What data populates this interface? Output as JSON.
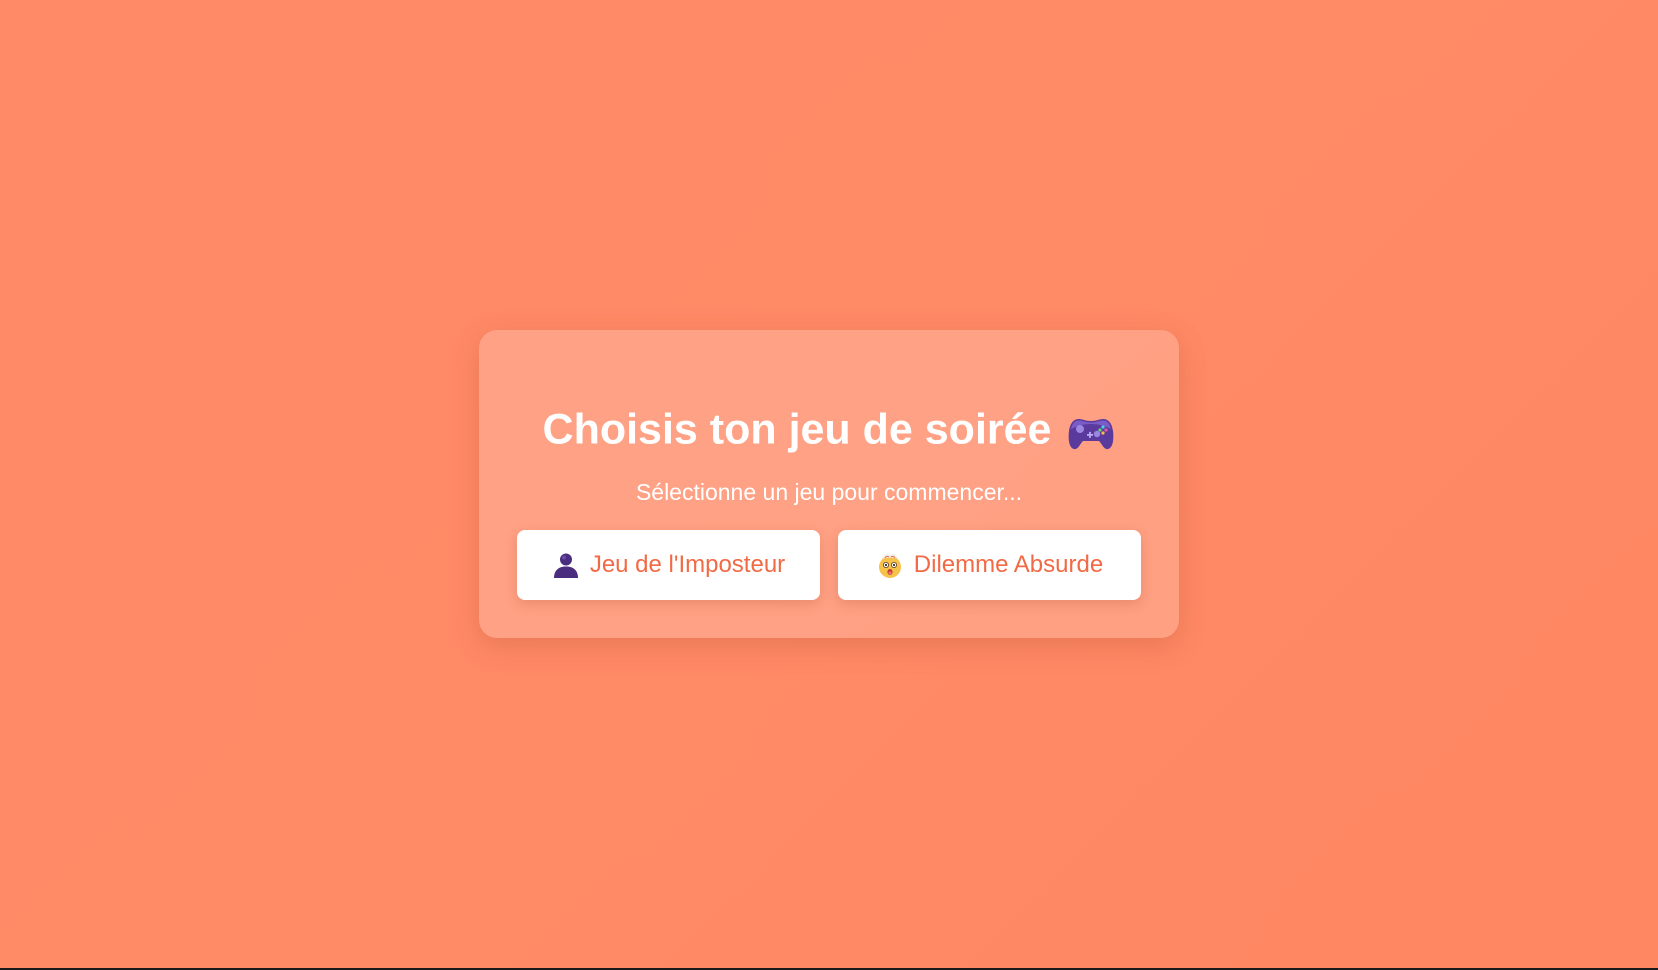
{
  "card": {
    "title": "Choisis ton jeu de soirée",
    "title_icon": "game-controller-icon",
    "subtitle": "Sélectionne un jeu pour commencer..."
  },
  "games": [
    {
      "label": "Jeu de l'Imposteur",
      "icon": "bust-silhouette-icon"
    },
    {
      "label": "Dilemme Absurde",
      "icon": "exploding-head-icon"
    }
  ],
  "colors": {
    "background": "#ff8764",
    "button_text": "#f26a45",
    "button_bg": "#ffffff",
    "title_text": "#ffffff"
  }
}
